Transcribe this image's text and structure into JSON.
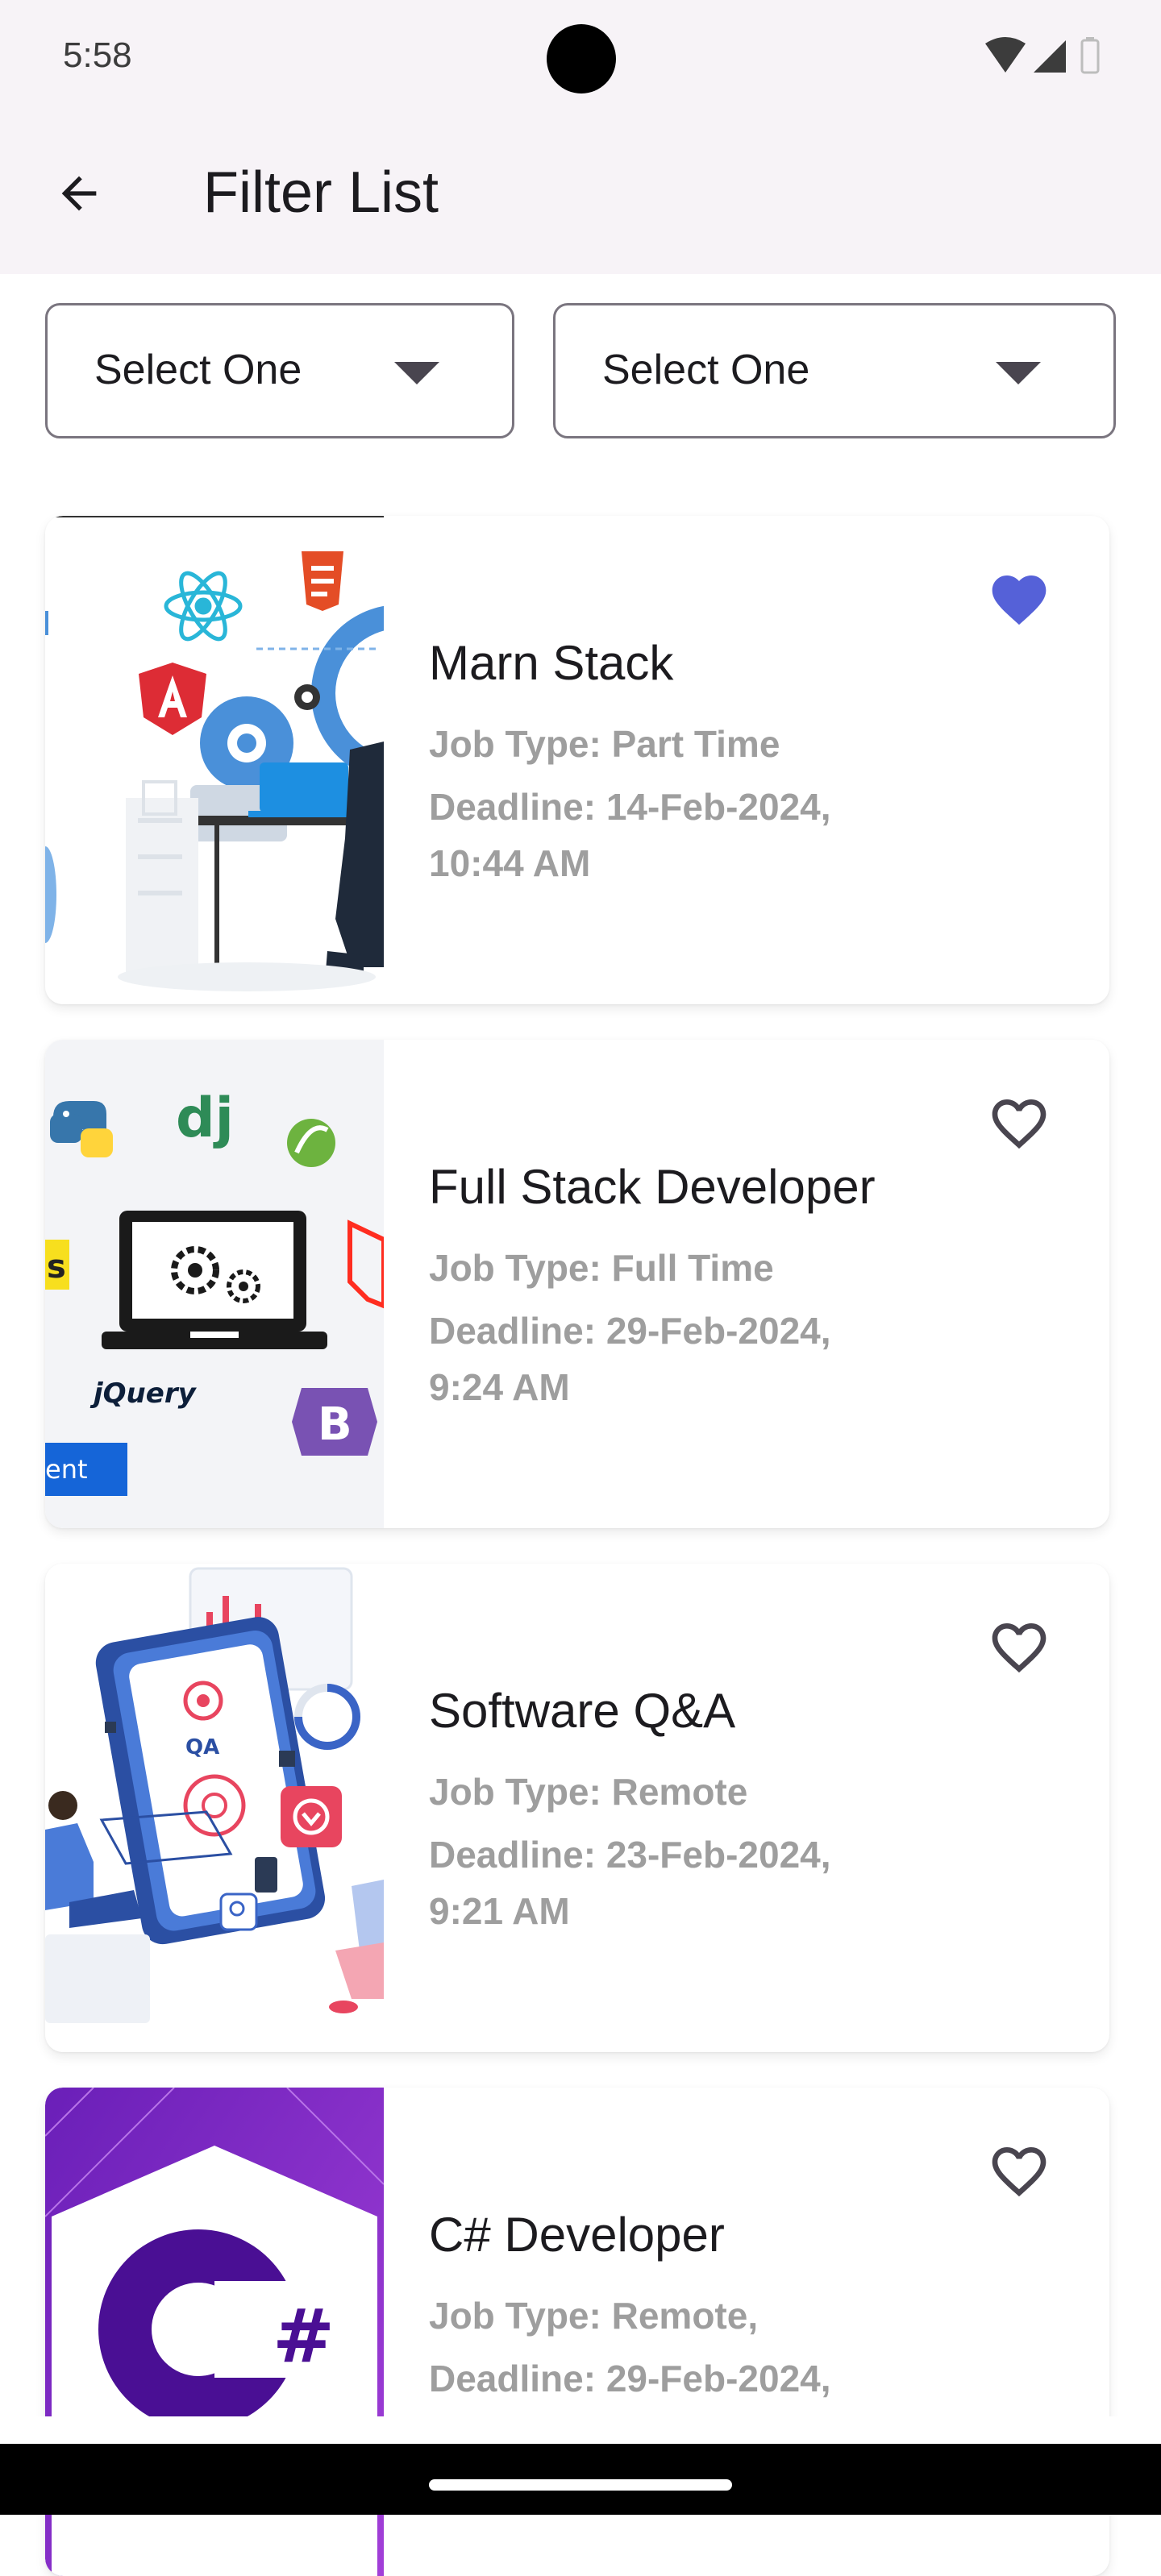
{
  "status_bar": {
    "time": "5:58",
    "icons": [
      "wifi-icon",
      "cellular-signal-icon",
      "battery-icon"
    ]
  },
  "app_bar": {
    "back_icon": "arrow-back-icon",
    "title": "Filter List"
  },
  "filters": [
    {
      "label": "Select One",
      "icon": "dropdown-caret-icon"
    },
    {
      "label": "Select One",
      "icon": "dropdown-caret-icon"
    }
  ],
  "jobs": [
    {
      "title": "Marn Stack",
      "job_type": "Job Type: Part Time",
      "deadline_line1": "Deadline: 14-Feb-2024,",
      "deadline_line2": "10:44 AM",
      "favorite": true,
      "image_icon": "web-development-illustration"
    },
    {
      "title": "Full Stack Developer",
      "job_type": "Job Type: Full Time",
      "deadline_line1": "Deadline: 29-Feb-2024,",
      "deadline_line2": "9:24 AM",
      "favorite": false,
      "image_icon": "full-stack-illustration",
      "image_text_jquery": "jQuery",
      "image_text_dj": "dj",
      "image_text_b": "B",
      "image_text_s": "s",
      "image_text_ent": "ent"
    },
    {
      "title": "Software Q&A",
      "job_type": "Job Type: Remote",
      "deadline_line1": "Deadline: 23-Feb-2024,",
      "deadline_line2": "9:21 AM",
      "favorite": false,
      "image_icon": "qa-testing-illustration",
      "image_text_qa": "QA"
    },
    {
      "title": "C# Developer",
      "job_type": "Job Type: Remote,",
      "deadline_line1": "Deadline: 29-Feb-2024,",
      "deadline_line2": "",
      "favorite": false,
      "image_icon": "csharp-logo",
      "image_text_hash": "#"
    }
  ],
  "colors": {
    "favorite_filled": "#5561d8",
    "favorite_outline": "#49454f",
    "bar_background": "#f7f3f7",
    "secondary_text": "#9e9e9e"
  }
}
